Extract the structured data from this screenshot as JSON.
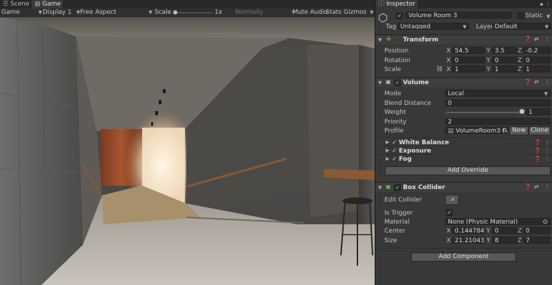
{
  "left_tabs": [
    "Scene",
    "Game"
  ],
  "toolbar": {
    "display_mode": "Game",
    "display": "Display 1",
    "aspect": "Free Aspect",
    "scale_label": "Scale",
    "scale_value": "1x",
    "render_mode": "Normally",
    "mute_audio": "Mute Audio",
    "stats": "Stats",
    "gizmos": "Gizmos"
  },
  "inspector": {
    "tab": "Inspector",
    "object_name": "Volume Room 3",
    "static_label": "Static",
    "tag_label": "Tag",
    "tag_value": "Untagged",
    "layer_label": "Layer",
    "layer_value": "Default",
    "transform": {
      "title": "Transform",
      "position_label": "Position",
      "rotation_label": "Rotation",
      "scale_label": "Scale",
      "position": {
        "x": "54.5",
        "y": "3.5",
        "z": "-0.2"
      },
      "rotation": {
        "x": "0",
        "y": "0",
        "z": "0"
      },
      "scale": {
        "x": "1",
        "y": "1",
        "z": "1"
      }
    },
    "volume": {
      "title": "Volume",
      "mode_label": "Mode",
      "mode_value": "Local",
      "blend_label": "Blend Distance",
      "blend_value": "0",
      "weight_label": "Weight",
      "weight_value": "1",
      "priority_label": "Priority",
      "priority_value": "2",
      "profile_label": "Profile",
      "profile_value": "VolumeRoom3 (Vo",
      "new_btn": "New",
      "clone_btn": "Clone",
      "overrides": [
        "White Balance",
        "Exposure",
        "Fog"
      ],
      "add_override": "Add Override"
    },
    "box_collider": {
      "title": "Box Collider",
      "edit_label": "Edit Collider",
      "trigger_label": "Is Trigger",
      "material_label": "Material",
      "material_value": "None (Physic Material)",
      "center_label": "Center",
      "center": {
        "x": "0.144784",
        "y": "0",
        "z": "0"
      },
      "size_label": "Size",
      "size": {
        "x": "21.21043",
        "y": "8",
        "z": "7"
      }
    },
    "add_component": "Add Component",
    "axis_labels": {
      "x": "X",
      "y": "Y",
      "z": "Z"
    }
  }
}
